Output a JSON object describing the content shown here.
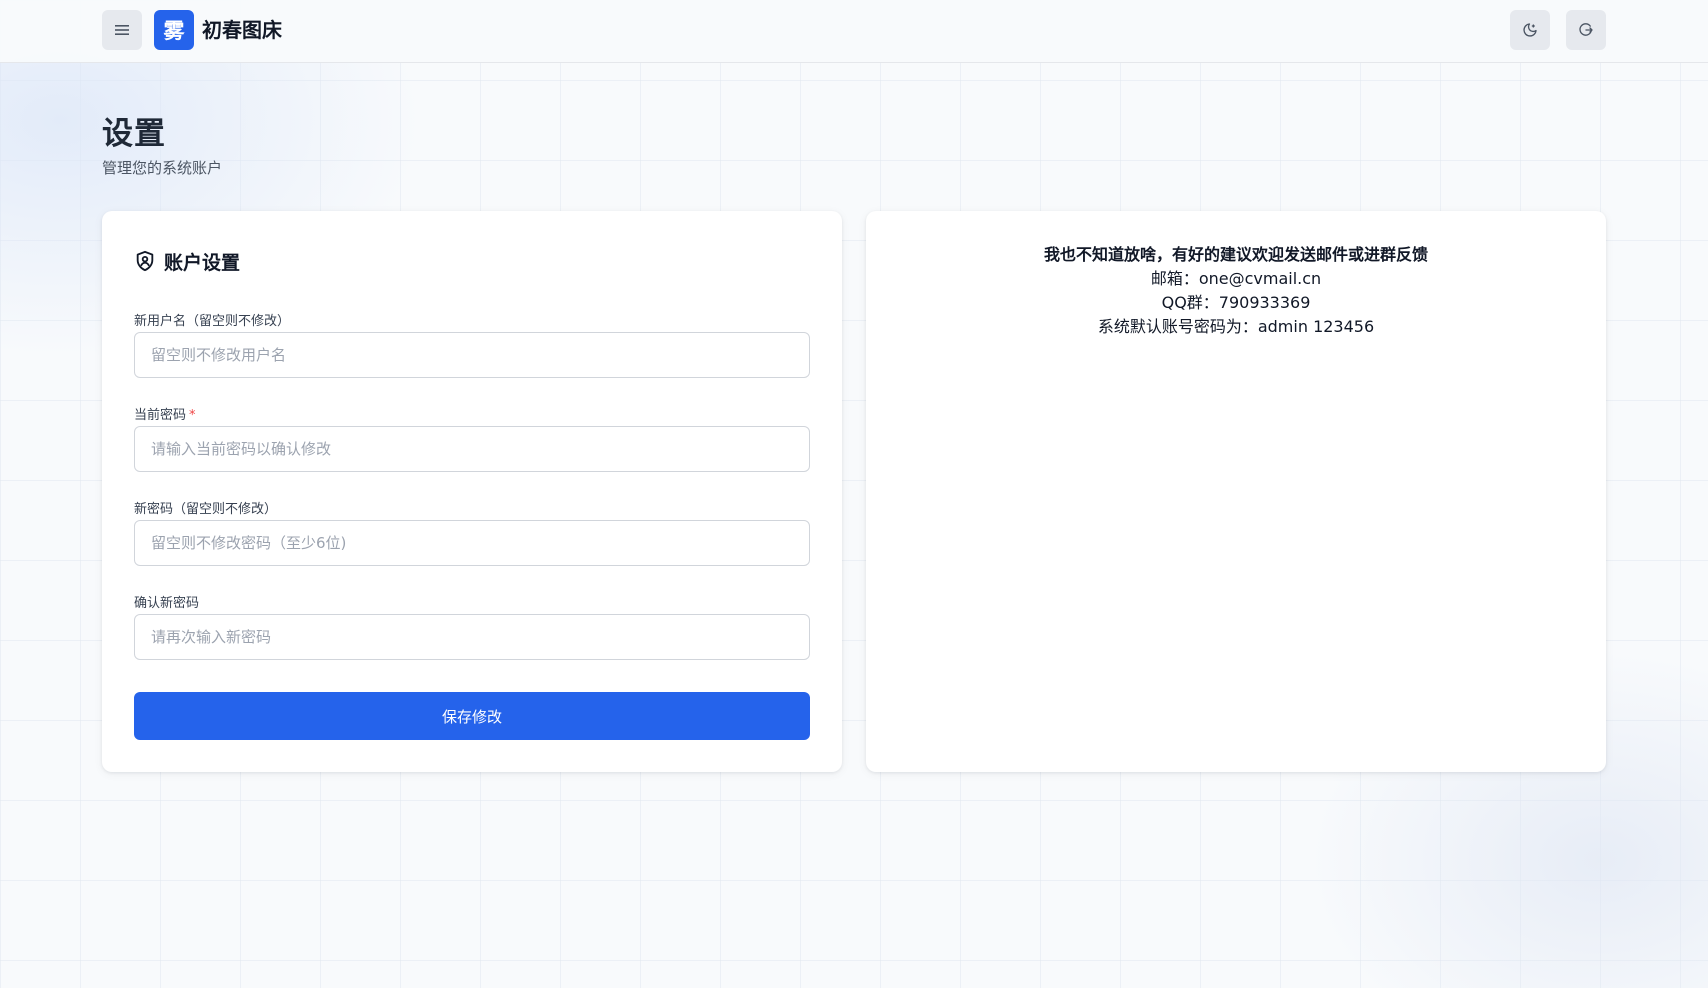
{
  "header": {
    "logo_char": "雾",
    "brand": "初春图床"
  },
  "page": {
    "title": "设置",
    "subtitle": "管理您的系统账户"
  },
  "account_card": {
    "title": "账户设置",
    "fields": [
      {
        "label": "新用户名（留空则不修改）",
        "placeholder": "留空则不修改用户名",
        "value": "",
        "required": false
      },
      {
        "label": "当前密码",
        "placeholder": "请输入当前密码以确认修改",
        "value": "",
        "required": true,
        "required_mark": "*"
      },
      {
        "label": "新密码（留空则不修改）",
        "placeholder": "留空则不修改密码（至少6位)",
        "value": "",
        "required": false
      },
      {
        "label": "确认新密码",
        "placeholder": "请再次输入新密码",
        "value": "",
        "required": false
      }
    ],
    "save_label": "保存修改"
  },
  "info_card": {
    "title": "我也不知道放啥，有好的建议欢迎发送邮件或进群反馈",
    "email_line": "邮箱：one@cvmail.cn",
    "qq_line": "QQ群：790933369",
    "default_line": "系统默认账号密码为：admin 123456"
  },
  "colors": {
    "accent": "#2563eb",
    "required": "#ef4444"
  }
}
